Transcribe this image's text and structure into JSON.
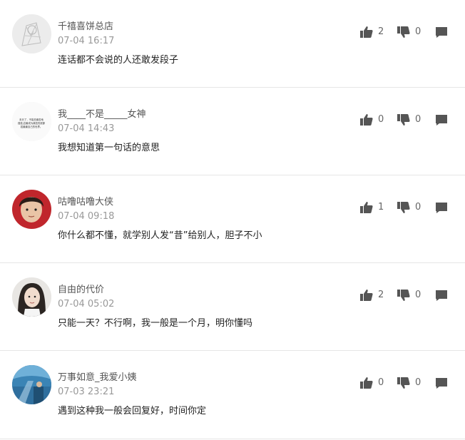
{
  "comments": [
    {
      "name": "千禧喜饼总店",
      "time": "07-04 16:17",
      "text": "连话都不会说的人还敢发段子",
      "likes": "2",
      "dislikes": "0",
      "avatar_style": "sketch-gray"
    },
    {
      "name": "我____不是_____女神",
      "time": "07-04 14:43",
      "text": "我想知道第一句话的意思",
      "likes": "0",
      "dislikes": "0",
      "avatar_style": "text-image",
      "avatar_text": [
        "未天了，不能总痛苦地",
        "强强,应最成为痛苦的统那",
        "若最最自己的世界。"
      ]
    },
    {
      "name": "咕噜咕噜大侠",
      "time": "07-04 09:18",
      "text": "你什么都不懂，就学别人发“昔”给别人，胆子不小",
      "likes": "1",
      "dislikes": "0",
      "avatar_style": "child-red"
    },
    {
      "name": "自由的代价",
      "time": "07-04 05:02",
      "text": "只能一天？不行啊，我一般是一个月，明你懂吗",
      "likes": "2",
      "dislikes": "0",
      "avatar_style": "girl-portrait"
    },
    {
      "name": "万事如意_我爱小姨",
      "time": "07-03 23:21",
      "text": "遇到这种我一般会回复好，时间你定",
      "likes": "0",
      "dislikes": "0",
      "avatar_style": "aquarium-blue"
    }
  ],
  "icons": {
    "like": "thumbs-up-icon",
    "dislike": "thumbs-down-icon",
    "reply": "comment-icon"
  },
  "colors": {
    "icon": "#555555",
    "name": "#555555",
    "time": "#999999",
    "text": "#222222",
    "divider": "#e6e6e6"
  }
}
